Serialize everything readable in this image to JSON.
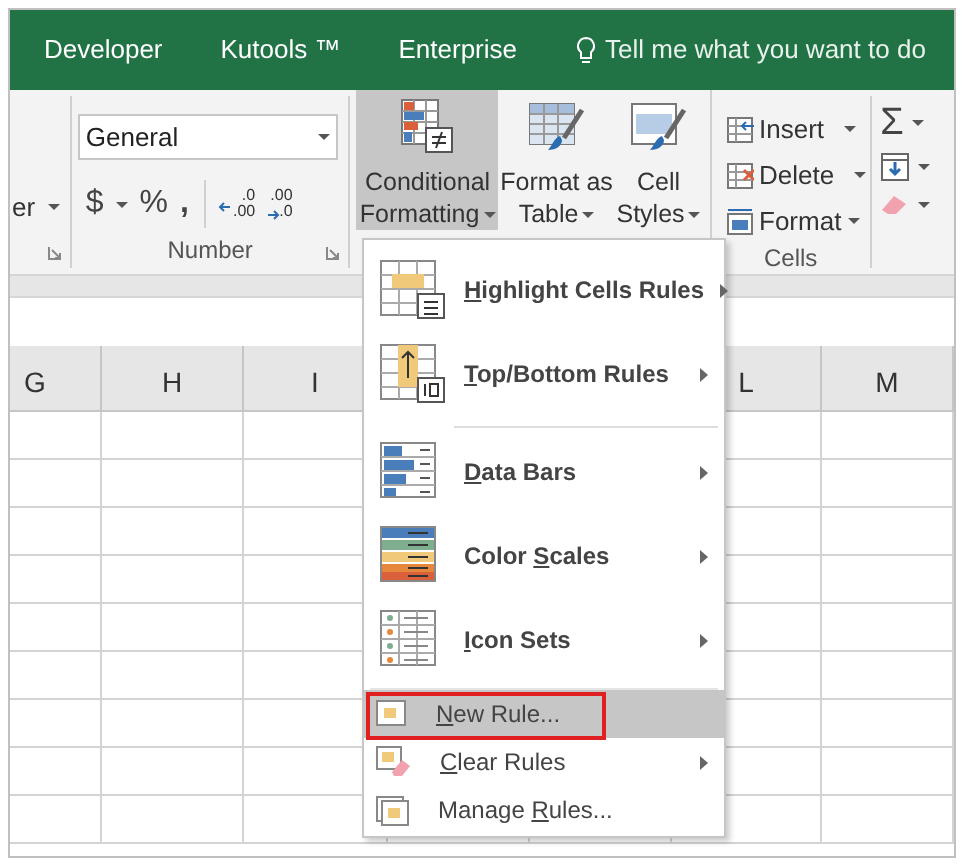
{
  "ribbon_tabs": [
    {
      "label": "Developer"
    },
    {
      "label": "Kutools ™"
    },
    {
      "label": "Enterprise"
    }
  ],
  "tell_me": {
    "placeholder": "Tell me what you want to do"
  },
  "ribbon": {
    "alignment_cut_label": "er",
    "number_group": {
      "label": "Number",
      "format": "General",
      "currency": "$",
      "percent": "%",
      "comma": ",",
      "decimals": [
        {
          "upper": ".0",
          "lower": ".00"
        },
        {
          "upper": ".00",
          "lower": ".0"
        }
      ]
    },
    "styles_group": [
      {
        "label": "Conditional",
        "label2": "Formatting",
        "selected": true
      },
      {
        "label": "Format as",
        "label2": "Table",
        "selected": false
      },
      {
        "label": "Cell",
        "label2": "Styles",
        "selected": false
      }
    ],
    "cells_group": {
      "label": "Cells",
      "buttons": [
        {
          "label": "Insert"
        },
        {
          "label": "Delete"
        },
        {
          "label": "Format"
        }
      ]
    },
    "editing_group": {
      "sum": "Σ"
    }
  },
  "columns": [
    {
      "label": "G"
    },
    {
      "label": "H"
    },
    {
      "label": "I"
    },
    {
      "label": "L"
    },
    {
      "label": "M"
    }
  ],
  "menu": [
    {
      "kind": "large",
      "mnemonic": "H",
      "text_after": "ighlight Cells Rules",
      "submenu": true,
      "selected": false,
      "annotated": false
    },
    {
      "kind": "large",
      "mnemonic": "T",
      "text_after": "op/Bottom Rules",
      "submenu": true,
      "selected": false,
      "annotated": false
    },
    {
      "kind": "separator"
    },
    {
      "kind": "large",
      "mnemonic": "D",
      "text_after": "ata Bars",
      "submenu": true,
      "selected": false,
      "annotated": false
    },
    {
      "kind": "large",
      "text_before": "Color ",
      "mnemonic": "S",
      "text_after": "cales",
      "submenu": true,
      "selected": false,
      "annotated": false
    },
    {
      "kind": "large",
      "mnemonic": "I",
      "text_after": "con Sets",
      "submenu": true,
      "selected": false,
      "annotated": false
    },
    {
      "kind": "separator"
    },
    {
      "kind": "small",
      "mnemonic": "N",
      "text_after": "ew Rule...",
      "submenu": false,
      "selected": true,
      "annotated": true
    },
    {
      "kind": "small",
      "mnemonic": "C",
      "text_after": "lear Rules",
      "submenu": true,
      "selected": false,
      "annotated": false
    },
    {
      "kind": "small",
      "text_before": "Manage ",
      "mnemonic": "R",
      "text_after": "ules...",
      "submenu": false,
      "selected": false,
      "annotated": false
    }
  ]
}
